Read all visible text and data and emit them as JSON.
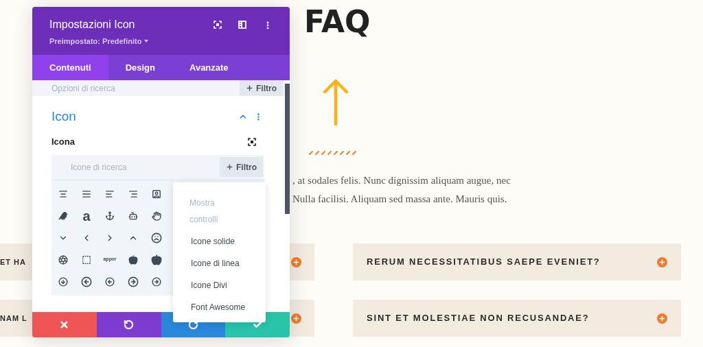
{
  "page": {
    "title": "FAQ",
    "paragraph_lines": [
      ", at sodales felis. Nunc dignissim aliquam augue, nec",
      "Nulla facilisi. Aliquam sed massa ante. Mauris quis."
    ],
    "faq_left": [
      {
        "title": "ET HA"
      },
      {
        "title": "NAM L"
      }
    ],
    "faq_right": [
      {
        "title": "RERUM NECESSITATIBUS SAEPE EVENIET?"
      },
      {
        "title": "SINT ET MOLESTIAE NON RECUSANDAE?"
      }
    ]
  },
  "settings_panel": {
    "title": "Impostazioni Icon",
    "preset": "Preimpostato: Predefinito",
    "tabs": [
      {
        "label": "Contenuti",
        "selected": true
      },
      {
        "label": "Design",
        "selected": false
      },
      {
        "label": "Avanzate",
        "selected": false
      }
    ],
    "search": {
      "placeholder": "Opzioni di ricerca",
      "filter": "Filtro"
    },
    "section": {
      "title": "Icon",
      "expanded": true,
      "field_label": "Icona",
      "icon_search": {
        "placeholder": "Icone di ricerca",
        "filter": "Filtro"
      },
      "icon_grid": {
        "text_glyphs": [
          "a",
          "apper"
        ]
      }
    },
    "filter_menu": {
      "heading": "Mostra controlli",
      "items": [
        "Icone solide",
        "Icone di linea",
        "Icone Divi",
        "Font Awesome"
      ]
    }
  }
}
